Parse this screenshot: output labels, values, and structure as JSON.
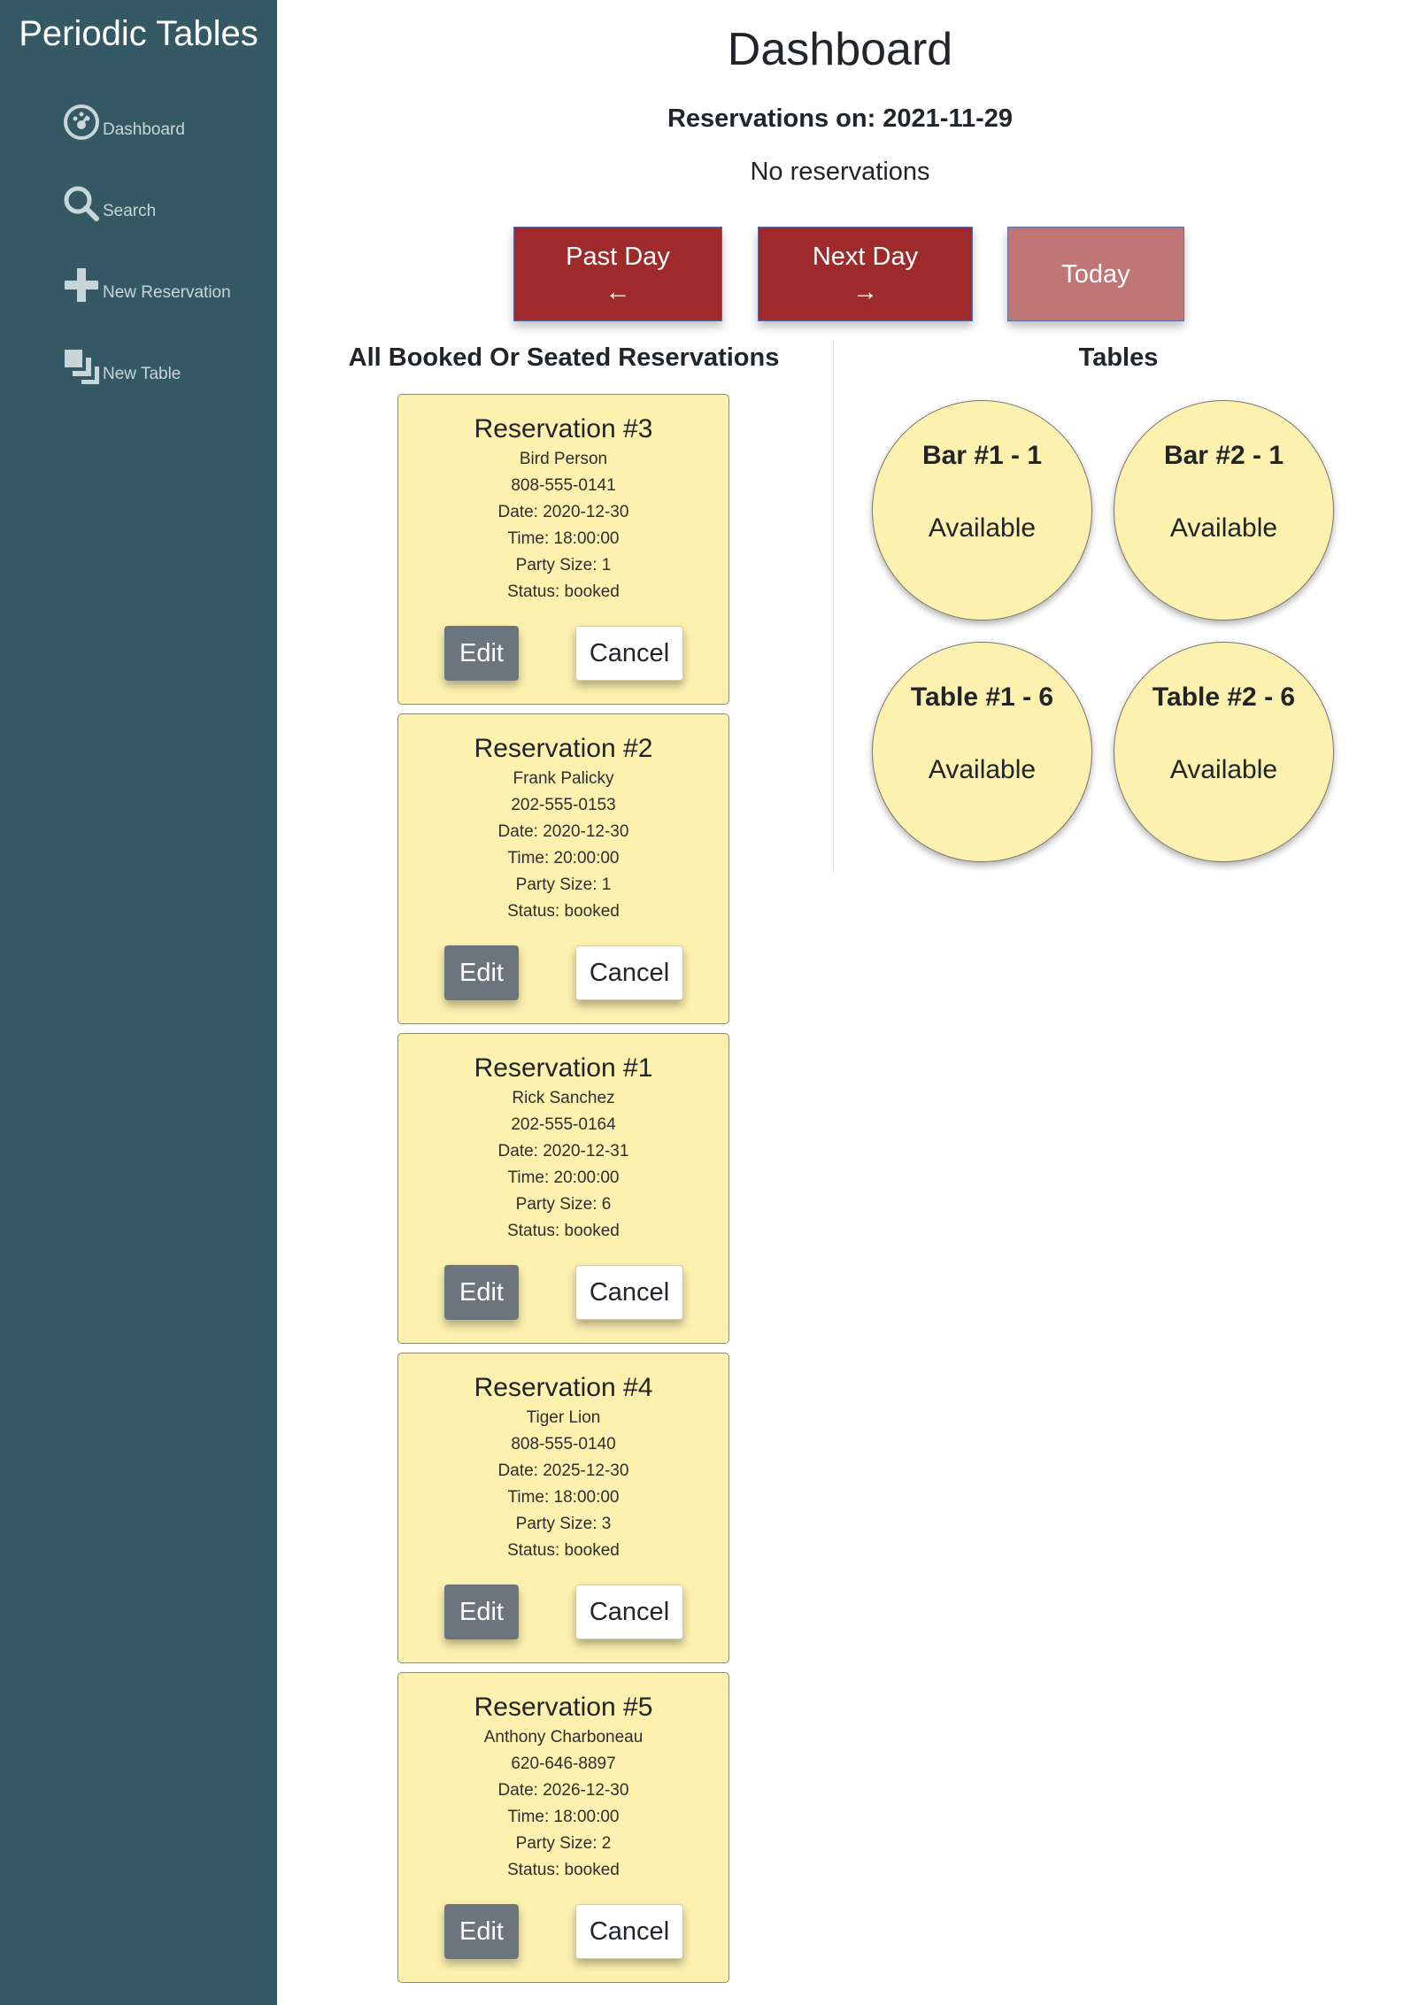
{
  "sidebar": {
    "brand": "Periodic Tables",
    "items": [
      {
        "label": "Dashboard",
        "icon": "dashboard-icon"
      },
      {
        "label": "Search",
        "icon": "search-icon"
      },
      {
        "label": "New Reservation",
        "icon": "plus-icon"
      },
      {
        "label": "New Table",
        "icon": "layers-icon"
      }
    ],
    "colors": {
      "background": "#345964",
      "text": "#c8d5d9"
    }
  },
  "main": {
    "title": "Dashboard",
    "reservations_on": "Reservations on: 2021-11-29",
    "no_reservations": "No reservations",
    "buttons": {
      "past": {
        "label": "Past Day",
        "arrow": "←"
      },
      "next": {
        "label": "Next Day",
        "arrow": "→"
      },
      "today": {
        "label": "Today"
      }
    },
    "reservations_heading": "All Booked Or Seated Reservations",
    "tables_heading": "Tables",
    "colors": {
      "accent": "#9e2a2b",
      "accent_disabled": "#c07676",
      "card": "#fdf1b0",
      "edit": "#6c757d"
    }
  },
  "reservations": [
    {
      "title": "Reservation #3",
      "name": "Bird Person",
      "phone": "808-555-0141",
      "date": "Date: 2020-12-30",
      "time": "Time: 18:00:00",
      "party": "Party Size: 1",
      "status": "Status: booked",
      "edit": "Edit",
      "cancel": "Cancel"
    },
    {
      "title": "Reservation #2",
      "name": "Frank Palicky",
      "phone": "202-555-0153",
      "date": "Date: 2020-12-30",
      "time": "Time: 20:00:00",
      "party": "Party Size: 1",
      "status": "Status: booked",
      "edit": "Edit",
      "cancel": "Cancel"
    },
    {
      "title": "Reservation #1",
      "name": "Rick Sanchez",
      "phone": "202-555-0164",
      "date": "Date: 2020-12-31",
      "time": "Time: 20:00:00",
      "party": "Party Size: 6",
      "status": "Status: booked",
      "edit": "Edit",
      "cancel": "Cancel"
    },
    {
      "title": "Reservation #4",
      "name": "Tiger Lion",
      "phone": "808-555-0140",
      "date": "Date: 2025-12-30",
      "time": "Time: 18:00:00",
      "party": "Party Size: 3",
      "status": "Status: booked",
      "edit": "Edit",
      "cancel": "Cancel"
    },
    {
      "title": "Reservation #5",
      "name": "Anthony Charboneau",
      "phone": "620-646-8897",
      "date": "Date: 2026-12-30",
      "time": "Time: 18:00:00",
      "party": "Party Size: 2",
      "status": "Status: booked",
      "edit": "Edit",
      "cancel": "Cancel"
    }
  ],
  "tables": [
    {
      "name": "Bar #1 - 1",
      "status": "Available"
    },
    {
      "name": "Bar #2 - 1",
      "status": "Available"
    },
    {
      "name": "Table #1 - 6",
      "status": "Available"
    },
    {
      "name": "Table #2 - 6",
      "status": "Available"
    }
  ]
}
